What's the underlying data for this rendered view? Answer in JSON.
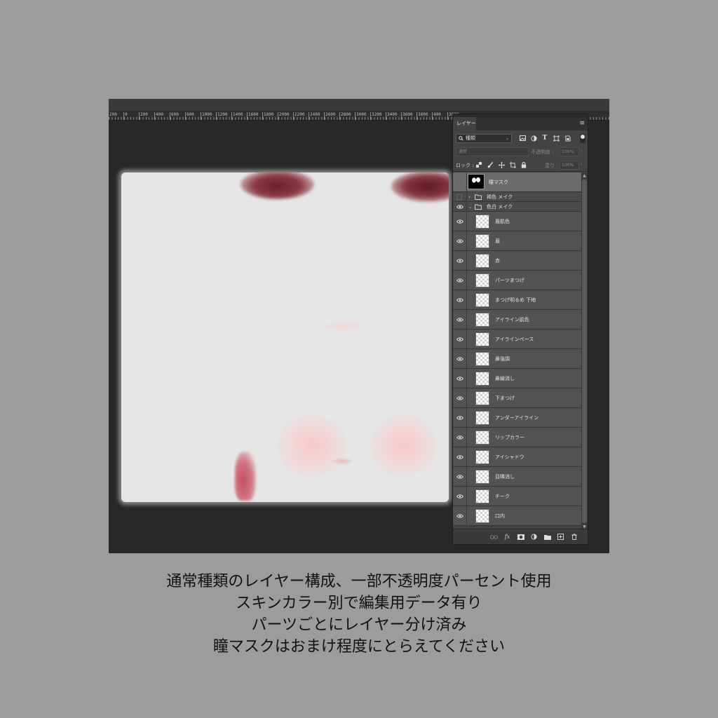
{
  "ruler": {
    "labels": [
      "200",
      "0",
      "200",
      "400",
      "600",
      "800",
      "1000",
      "1200",
      "1400",
      "1600",
      "1800",
      "2000",
      "2200",
      "2400",
      "2600",
      "2800",
      "3000",
      "3200",
      "3400",
      "3600",
      "3800",
      "400",
      "3800"
    ]
  },
  "panel": {
    "tab_label": "レイヤー",
    "filter_kind": "種類",
    "blend_mode": "通常",
    "opacity_label": "不透明度 :",
    "opacity_value": "100%",
    "lock_label": "ロック :",
    "fill_label": "塗り :",
    "fill_value": "100%",
    "icons": {
      "filter_image": "image-filter-icon",
      "filter_adjust": "adjustment-filter-icon",
      "filter_type": "type-filter-icon",
      "filter_shape": "shape-filter-icon",
      "filter_smart": "smart-object-filter-icon",
      "link": "link-icon",
      "fx": "fx",
      "mask": "mask-icon",
      "adjust": "adjustment-icon",
      "folder": "folder-icon",
      "new": "new-layer-icon",
      "trash": "trash-icon"
    }
  },
  "layers": [
    {
      "name": "瞳マスク",
      "type": "mask",
      "visible": false,
      "selected": true
    },
    {
      "name": "褐色 メイク",
      "type": "group",
      "visible": false,
      "collapsed": true
    },
    {
      "name": "色白 メイク",
      "type": "group",
      "visible": true,
      "collapsed": false
    },
    {
      "name": "眉肌色",
      "type": "layer",
      "visible": true
    },
    {
      "name": "眉",
      "type": "layer",
      "visible": true
    },
    {
      "name": "赤",
      "type": "layer",
      "visible": true
    },
    {
      "name": "パーツまつげ",
      "type": "layer",
      "visible": true
    },
    {
      "name": "まつげ明るめ 下地",
      "type": "layer",
      "visible": true
    },
    {
      "name": "アイライン肌色",
      "type": "layer",
      "visible": true
    },
    {
      "name": "アイラインベース",
      "type": "layer",
      "visible": true
    },
    {
      "name": "鼻強調",
      "type": "layer",
      "visible": true
    },
    {
      "name": "鼻線消し",
      "type": "layer",
      "visible": true
    },
    {
      "name": "下まつげ",
      "type": "layer",
      "visible": true
    },
    {
      "name": "アンダーアイライン",
      "type": "layer",
      "visible": true
    },
    {
      "name": "リップカラー",
      "type": "layer",
      "visible": true
    },
    {
      "name": "アイシャドウ",
      "type": "layer",
      "visible": true
    },
    {
      "name": "目隣消し",
      "type": "layer",
      "visible": true
    },
    {
      "name": "チーク",
      "type": "layer",
      "visible": true
    },
    {
      "name": "口内",
      "type": "layer",
      "visible": true
    }
  ],
  "caption": {
    "line1": "通常種類のレイヤー構成、一部不透明度パーセント使用",
    "line2": "スキンカラー別で編集用データ有り",
    "line3": "パーツごとにレイヤー分け済み",
    "line4": "瞳マスクはおまけ程度にとらえてください"
  },
  "colors": {
    "background": "#9c9c9c",
    "workspace": "#282828",
    "panel": "#434343",
    "selected_layer": "#6b6b6b",
    "brow_red": "#7a2a34",
    "cheek_pink": "#f2c4c8"
  }
}
